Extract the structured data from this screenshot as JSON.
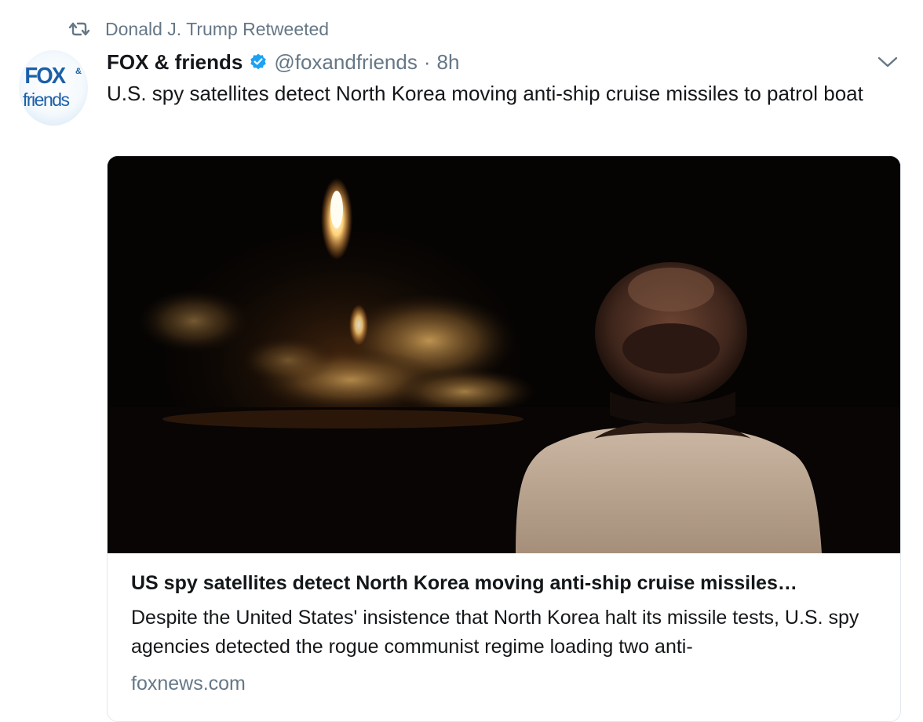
{
  "retweet": {
    "icon": "retweet-icon",
    "text": "Donald J. Trump Retweeted"
  },
  "tweet": {
    "avatar": {
      "logo_line1": "FOX",
      "logo_amp": "&",
      "logo_line2": "friends"
    },
    "author_name": "FOX & friends",
    "verified_icon": "verified-badge-icon",
    "handle": "@foxandfriends",
    "separator": "·",
    "time": "8h",
    "menu_icon": "chevron-down-icon",
    "text": "U.S. spy satellites detect North Korea moving anti-ship cruise missiles to patrol boat"
  },
  "card": {
    "image_description_icon": "missile-launch-photo",
    "title": "US spy satellites detect North Korea moving anti-ship cruise missiles…",
    "description": "Despite the United States' insistence that North Korea halt its missile tests, U.S. spy agencies detected the rogue communist regime loading two anti-",
    "domain": "foxnews.com"
  },
  "colors": {
    "secondary_text": "#657786",
    "primary_text": "#14171a",
    "verified_blue": "#1da1f2",
    "brand_blue": "#1c5fa8"
  }
}
